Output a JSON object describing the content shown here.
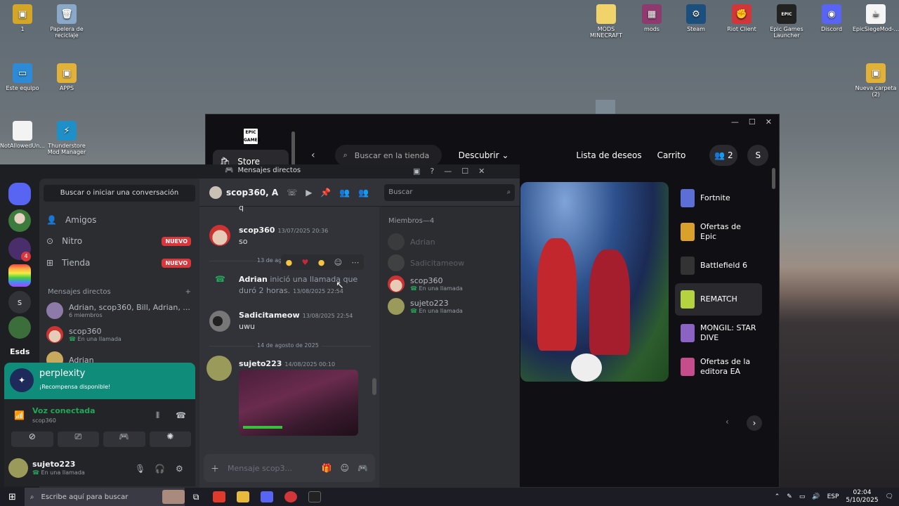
{
  "desktop": {
    "icons": [
      {
        "label": "1",
        "color": "#d4a627",
        "glyph": "▣"
      },
      {
        "label": "Papelera de reciclaje",
        "color": "#8aa9c8",
        "glyph": "🗑"
      },
      {
        "label": "Este equipo",
        "color": "#2d8ad6",
        "glyph": "▭"
      },
      {
        "label": "APPS",
        "color": "#e0b23a",
        "glyph": "▣"
      },
      {
        "label": "NotAllowedUn...",
        "color": "#f3f3f3",
        "glyph": ""
      },
      {
        "label": "Thunderstore Mod Manager",
        "color": "#1f8fc8",
        "glyph": "⚡"
      },
      {
        "label": "MODS MINECRAFT",
        "color": "#f0d36b",
        "glyph": ""
      },
      {
        "label": "mods",
        "color": "#8e3a6f",
        "glyph": "▦"
      },
      {
        "label": "Steam",
        "color": "#1b4f7e",
        "glyph": "⚙"
      },
      {
        "label": "Riot Client",
        "color": "#d13639",
        "glyph": "✊"
      },
      {
        "label": "Epic Games Launcher",
        "color": "#222",
        "glyph": "EPIC"
      },
      {
        "label": "Discord",
        "color": "#5865f2",
        "glyph": "◉"
      },
      {
        "label": "EpicSiegeMod-...",
        "color": "#f5f5f5",
        "glyph": "☕"
      },
      {
        "label": "Nueva carpeta (2)",
        "color": "#e0b23a",
        "glyph": "▣"
      }
    ]
  },
  "epic": {
    "store_label": "Store",
    "search_placeholder": "Buscar en la tienda",
    "discover": "Descubrir",
    "wishlist": "Lista de deseos",
    "cart": "Carrito",
    "friends_count": "2",
    "profile_initial": "S",
    "games": [
      {
        "name": "Fortnite",
        "color": "#5b6fd6"
      },
      {
        "name": "Ofertas de Epic",
        "color": "#d9a02c"
      },
      {
        "name": "Battlefield 6",
        "color": "#333"
      },
      {
        "name": "REMATCH",
        "color": "#b5d340"
      },
      {
        "name": "MONGIL: STAR DIVE",
        "color": "#8b63c4"
      },
      {
        "name": "Ofertas de la editora EA",
        "color": "#c64d8c"
      }
    ]
  },
  "discord": {
    "window_title": "Mensajes directos",
    "search_convo": "Buscar o iniciar una conversación",
    "nav": {
      "friends": "Amigos",
      "nitro": "Nitro",
      "store": "Tienda",
      "new_badge": "NUEVO"
    },
    "dm_header": "Mensajes directos",
    "dms": [
      {
        "name": "Adrian, scop360, Bill, Adrian, ...",
        "sub": "6 miembros"
      },
      {
        "name": "scop360",
        "sub": "En una llamada"
      },
      {
        "name": "Adrian",
        "sub": ""
      }
    ],
    "server_label": "Esds",
    "server_s": "s",
    "rail_badge": "4",
    "promo": {
      "title": "perplexity",
      "sub": "¡Recompensa disponible!"
    },
    "voice": {
      "status": "Voz conectada",
      "channel": "scop360"
    },
    "user": {
      "name": "sujeto223",
      "status": "En una llamada"
    },
    "chat": {
      "header": "scop360, A",
      "search": "Buscar",
      "first_line": "q",
      "messages": [
        {
          "author": "scop360",
          "time": "13/07/2025 20:36",
          "text": "so"
        },
        {
          "date_divider": "13 de agos"
        },
        {
          "author": "Adrian",
          "action": "inició una llamada que duró 2 horas.",
          "time": "13/08/2025 22:54"
        },
        {
          "author": "Sadicitameow",
          "time": "13/08/2025 22:54",
          "text": "uwu"
        },
        {
          "date_divider": "14 de agosto de 2025"
        },
        {
          "author": "sujeto223",
          "time": "14/08/2025 00:10",
          "text": ""
        }
      ],
      "input_placeholder": "Mensaje scop3..."
    },
    "members": {
      "header": "Miembros—4",
      "list": [
        {
          "name": "Adrian",
          "status": "",
          "dim": true
        },
        {
          "name": "Sadicitameow",
          "status": "",
          "dim": true
        },
        {
          "name": "scop360",
          "status": "En una llamada",
          "dim": false
        },
        {
          "name": "sujeto223",
          "status": "En una llamada",
          "dim": false
        }
      ]
    }
  },
  "taskbar": {
    "search_placeholder": "Escribe aquí para buscar",
    "lang": "ESP",
    "time": "02:04",
    "date": "5/10/2025"
  }
}
